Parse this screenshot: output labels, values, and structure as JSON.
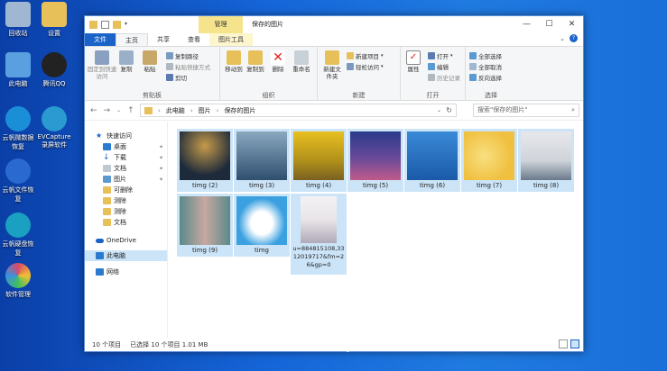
{
  "desktop": {
    "icons": [
      {
        "label": "回收站",
        "color": "#9fb7d0"
      },
      {
        "label": "设置",
        "color": "#e8c05a"
      },
      {
        "label": "此电脑",
        "color": "#5aa0e0"
      },
      {
        "label": "腾讯QQ",
        "color": "#222222"
      },
      {
        "label": "云帆微数据恢复",
        "color": "#1a8fd8"
      },
      {
        "label": "EVCapture 录屏软件",
        "color": "#2a9ad0"
      },
      {
        "label": "云帆文件恢复",
        "color": "#2a6ad0"
      },
      {
        "label": "云帆硬盘恢复",
        "color": "#1aa0c0"
      },
      {
        "label": "软件管理",
        "color": "#d84a6a"
      }
    ]
  },
  "window": {
    "title": "保存的图片",
    "context_tab": "管理",
    "tabs": [
      "文件",
      "主页",
      "共享",
      "查看",
      "图片工具"
    ],
    "minimize": "—",
    "maximize": "☐",
    "close": "✕",
    "ribbon": {
      "clipboard": {
        "label": "剪贴板",
        "pin": "固定到快速访问",
        "copy": "复制",
        "paste": "粘贴",
        "copy_path": "复制路径",
        "paste_shortcut": "粘贴快捷方式",
        "cut": "剪切"
      },
      "organize": {
        "label": "组织",
        "move_to": "移动到",
        "copy_to": "复制到",
        "delete": "删除",
        "rename": "重命名"
      },
      "new": {
        "label": "新建",
        "new_folder": "新建文件夹",
        "new_item": "新建项目",
        "easy_access": "轻松访问"
      },
      "open": {
        "label": "打开",
        "properties": "属性",
        "open": "打开",
        "edit": "编辑",
        "history": "历史记录"
      },
      "select": {
        "label": "选择",
        "select_all": "全部选择",
        "select_none": "全部取消",
        "invert": "反向选择"
      }
    },
    "address": {
      "crumbs": [
        "此电脑",
        "图片",
        "保存的图片"
      ],
      "search_placeholder": "搜索\"保存的图片\""
    },
    "nav_pane": {
      "quick_access": "快速访问",
      "items": [
        "桌面",
        "下载",
        "文档",
        "图片",
        "可删除",
        "测除",
        "测除",
        "文档"
      ],
      "onedrive": "OneDrive",
      "this_pc": "此电脑",
      "network": "网络"
    },
    "files": [
      {
        "name": "timg (2)",
        "c1": "#1d2a3a",
        "c2": "#c59a4a"
      },
      {
        "name": "timg (3)",
        "c1": "#2f4f6f",
        "c2": "#8aa8c0"
      },
      {
        "name": "timg (4)",
        "c1": "#e8c020",
        "c2": "#7a6020"
      },
      {
        "name": "timg (5)",
        "c1": "#2a3a8a",
        "c2": "#c05a8a"
      },
      {
        "name": "timg (6)",
        "c1": "#1a5aa8",
        "c2": "#3a8ad8"
      },
      {
        "name": "timg (7)",
        "c1": "#f0c040",
        "c2": "#f8e080"
      },
      {
        "name": "timg (8)",
        "c1": "#e8e8ec",
        "c2": "#6a7a8a"
      },
      {
        "name": "timg (9)",
        "c1": "#5a8a8a",
        "c2": "#c8a8a0"
      },
      {
        "name": "timg",
        "c1": "#3aa0e0",
        "c2": "#ffffff"
      },
      {
        "name": "u=884815108,3312019717&fm=26&gp=0",
        "c1": "#e8e4e8",
        "c2": "#b0a8b8"
      }
    ],
    "status": {
      "count": "10 个项目",
      "selected": "已选择 10 个项目 1.01 MB"
    }
  }
}
